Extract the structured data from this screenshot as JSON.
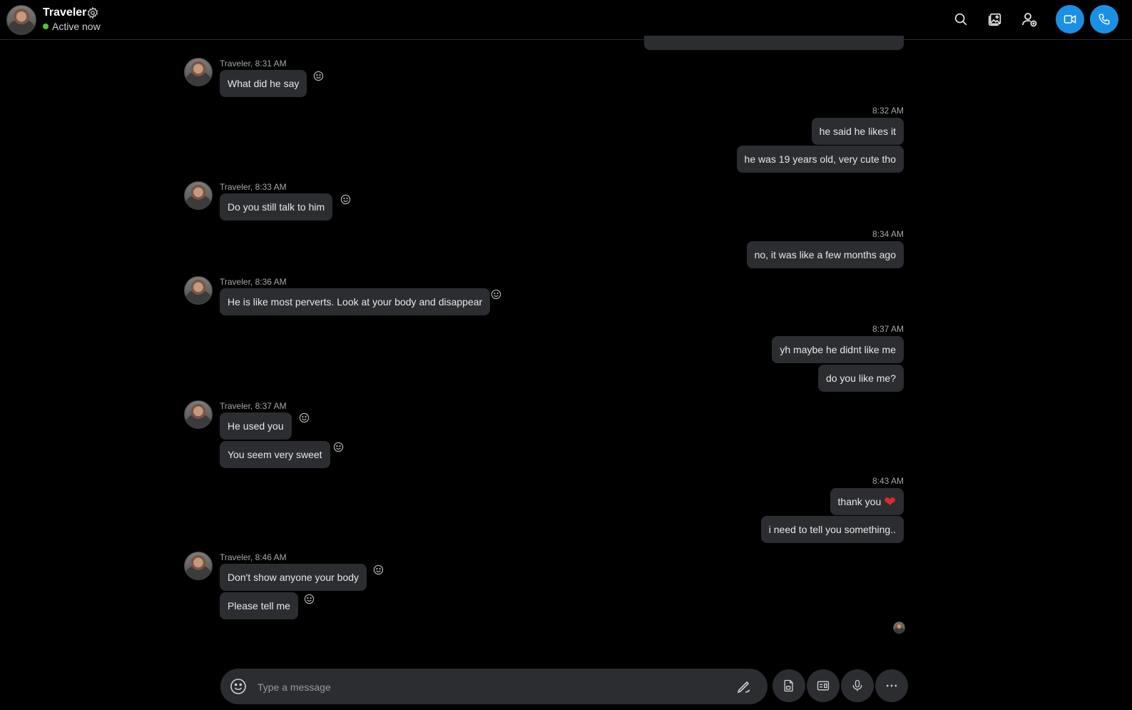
{
  "header": {
    "name": "Traveler",
    "status": "Active now"
  },
  "messages": {
    "m1": {
      "sender": "Traveler, 8:31 AM",
      "texts": [
        "What did he say"
      ]
    },
    "o1": {
      "time": "8:32 AM",
      "texts": [
        "he said he likes it",
        "he was 19 years old, very cute tho"
      ]
    },
    "m2": {
      "sender": "Traveler, 8:33 AM",
      "texts": [
        "Do you still talk to him"
      ]
    },
    "o2": {
      "time": "8:34 AM",
      "texts": [
        "no, it was like a few months ago"
      ]
    },
    "m3": {
      "sender": "Traveler, 8:36 AM",
      "texts": [
        "He is like most perverts.  Look at your body and disappear"
      ]
    },
    "o3": {
      "time": "8:37 AM",
      "texts": [
        "yh maybe he didnt like me",
        "do you like me?"
      ]
    },
    "m4": {
      "sender": "Traveler, 8:37 AM",
      "texts": [
        "He used you",
        "You seem very sweet"
      ]
    },
    "o4": {
      "time": "8:43 AM",
      "texts": [
        "thank you",
        "i need to tell you something.."
      ]
    },
    "m5": {
      "sender": "Traveler, 8:46 AM",
      "texts": [
        "Don't show anyone your body",
        "Please tell me"
      ]
    }
  },
  "composer": {
    "placeholder": "Type a message"
  },
  "colors": {
    "accent": "#1c8fe3",
    "bubble": "#2b2d31",
    "online": "#5bc236",
    "heart": "#e0282e"
  },
  "icons": [
    "settings-gear-icon",
    "search-icon",
    "gallery-icon",
    "add-person-icon",
    "video-call-icon",
    "phone-call-icon",
    "smiley-reaction-icon",
    "emoji-icon",
    "pen-icon",
    "file-share-icon",
    "contact-card-icon",
    "microphone-icon",
    "more-options-icon",
    "heart-emoji-icon"
  ]
}
